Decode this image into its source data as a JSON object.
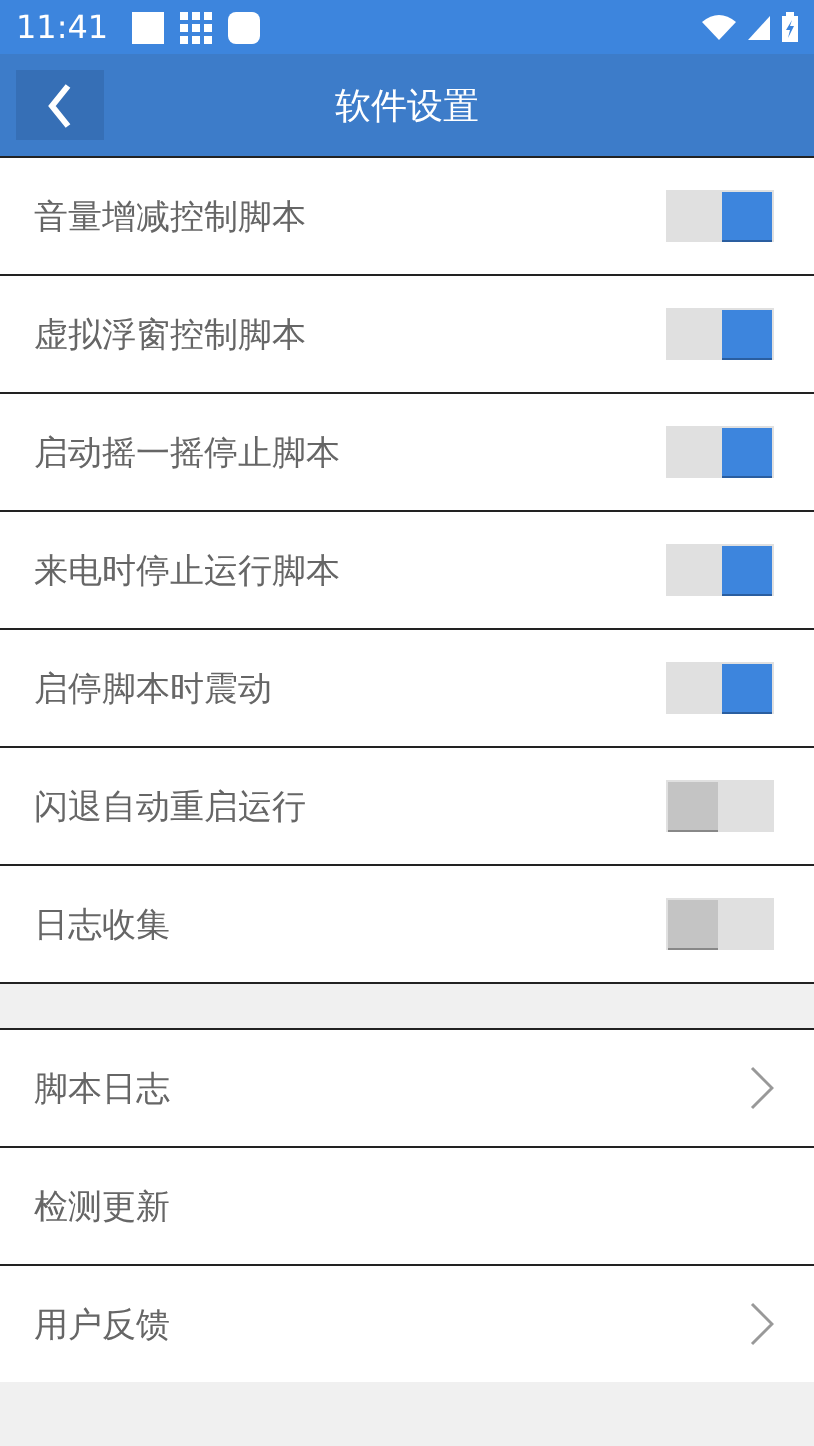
{
  "status_bar": {
    "time": "11:41"
  },
  "toolbar": {
    "title": "软件设置"
  },
  "toggles": [
    {
      "label": "音量增减控制脚本",
      "on": true
    },
    {
      "label": "虚拟浮窗控制脚本",
      "on": true
    },
    {
      "label": "启动摇一摇停止脚本",
      "on": true
    },
    {
      "label": "来电时停止运行脚本",
      "on": true
    },
    {
      "label": "启停脚本时震动",
      "on": true
    },
    {
      "label": "闪退自动重启运行",
      "on": false
    },
    {
      "label": "日志收集",
      "on": false
    }
  ],
  "links": [
    {
      "label": "脚本日志",
      "arrow": true
    },
    {
      "label": "检测更新",
      "arrow": false
    },
    {
      "label": "用户反馈",
      "arrow": true
    }
  ]
}
